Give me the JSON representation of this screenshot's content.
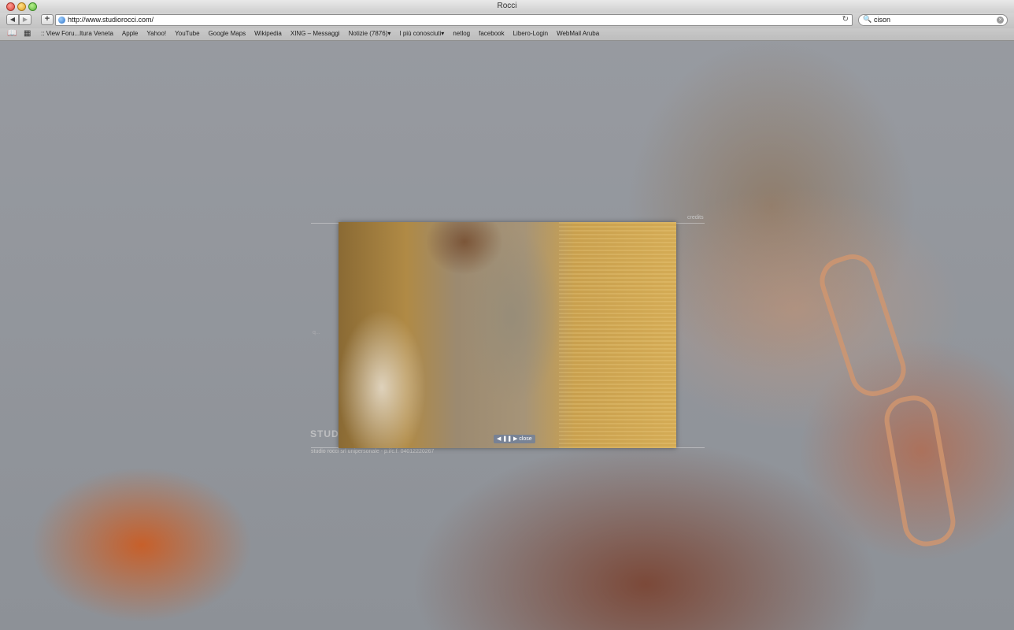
{
  "window": {
    "title": "Rocci"
  },
  "toolbar": {
    "back_glyph": "◀",
    "forward_glyph": "▶",
    "add_glyph": "+",
    "url": "http://www.studiorocci.com/",
    "reload_glyph": "↻",
    "search_glyph": "🔍",
    "search_value": "cison",
    "search_clear_glyph": "×"
  },
  "bookmarks": {
    "book_icon": "📖",
    "grid_icon": "▦",
    "items": [
      ":: View Foru...ltura Veneta",
      "Apple",
      "Yahoo!",
      "YouTube",
      "Google Maps",
      "Wikipedia",
      "XING – Messaggi",
      "Notizie (7876)▾",
      "I più conosciuti▾",
      "netlog",
      "facebook",
      "Libero-Login",
      "WebMail Aruba"
    ]
  },
  "page": {
    "credits": "credits",
    "logo_text": "STUD",
    "footer": "studio rocci srl unipersonale - p.i/c.f. 04012220267",
    "ghost_text": "q..."
  },
  "lightbox": {
    "controls": "◀ ❚❚ ▶ close"
  }
}
